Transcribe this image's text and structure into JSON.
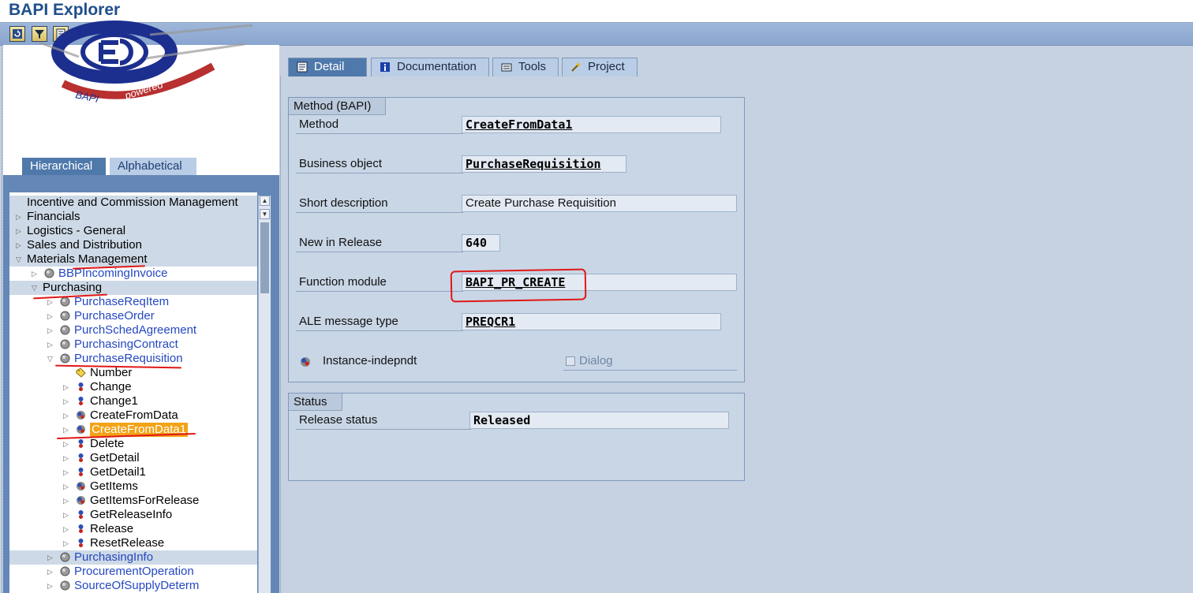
{
  "window": {
    "title": "BAPI Explorer"
  },
  "toolbar": {
    "buttons": [
      {
        "icon": "refresh-icon"
      },
      {
        "icon": "filter-icon"
      },
      {
        "icon": "list-icon"
      }
    ]
  },
  "logo": {
    "text": "BAPIpowered"
  },
  "left_tabs": {
    "hierarchical": "Hierarchical",
    "alphabetical": "Alphabetical"
  },
  "tree": {
    "rows": [
      {
        "label": "Incentive and Commission Management",
        "level": 0,
        "expand": "none",
        "type": "hdr"
      },
      {
        "label": "Financials",
        "level": 0,
        "expand": "closed",
        "type": "hdr"
      },
      {
        "label": "Logistics - General",
        "level": 0,
        "expand": "closed",
        "type": "hdr"
      },
      {
        "label": "Sales and Distribution",
        "level": 0,
        "expand": "closed",
        "type": "hdr"
      },
      {
        "label": "Materials Management",
        "level": 0,
        "expand": "open",
        "type": "hdr"
      },
      {
        "label": "BBPIncomingInvoice",
        "level": 1,
        "expand": "closed",
        "type": "link",
        "icon": "object"
      },
      {
        "label": "Purchasing",
        "level": 1,
        "expand": "open",
        "type": "hdr"
      },
      {
        "label": "PurchaseReqItem",
        "level": 2,
        "expand": "closed",
        "type": "link",
        "icon": "object"
      },
      {
        "label": "PurchaseOrder",
        "level": 2,
        "expand": "closed",
        "type": "link",
        "icon": "object"
      },
      {
        "label": "PurchSchedAgreement",
        "level": 2,
        "expand": "closed",
        "type": "link",
        "icon": "object"
      },
      {
        "label": "PurchasingContract",
        "level": 2,
        "expand": "closed",
        "type": "link",
        "icon": "object"
      },
      {
        "label": "PurchaseRequisition",
        "level": 2,
        "expand": "open",
        "type": "link",
        "icon": "object"
      },
      {
        "label": "Number",
        "level": 3,
        "expand": "none",
        "type": "plain",
        "icon": "key"
      },
      {
        "label": "Change",
        "level": 3,
        "expand": "closed",
        "type": "plain",
        "icon": "method"
      },
      {
        "label": "Change1",
        "level": 3,
        "expand": "closed",
        "type": "plain",
        "icon": "method"
      },
      {
        "label": "CreateFromData",
        "level": 3,
        "expand": "closed",
        "type": "plain",
        "icon": "static"
      },
      {
        "label": "CreateFromData1",
        "level": 3,
        "expand": "closed",
        "type": "sel",
        "icon": "static"
      },
      {
        "label": "Delete",
        "level": 3,
        "expand": "closed",
        "type": "plain",
        "icon": "method"
      },
      {
        "label": "GetDetail",
        "level": 3,
        "expand": "closed",
        "type": "plain",
        "icon": "method"
      },
      {
        "label": "GetDetail1",
        "level": 3,
        "expand": "closed",
        "type": "plain",
        "icon": "method"
      },
      {
        "label": "GetItems",
        "level": 3,
        "expand": "closed",
        "type": "plain",
        "icon": "static"
      },
      {
        "label": "GetItemsForRelease",
        "level": 3,
        "expand": "closed",
        "type": "plain",
        "icon": "static"
      },
      {
        "label": "GetReleaseInfo",
        "level": 3,
        "expand": "closed",
        "type": "plain",
        "icon": "method"
      },
      {
        "label": "Release",
        "level": 3,
        "expand": "closed",
        "type": "plain",
        "icon": "method"
      },
      {
        "label": "ResetRelease",
        "level": 3,
        "expand": "closed",
        "type": "plain",
        "icon": "method"
      },
      {
        "label": "PurchasingInfo",
        "level": 2,
        "expand": "closed",
        "type": "linkhdr",
        "icon": "object"
      },
      {
        "label": "ProcurementOperation",
        "level": 2,
        "expand": "closed",
        "type": "link",
        "icon": "object"
      },
      {
        "label": "SourceOfSupplyDeterm",
        "level": 2,
        "expand": "closed",
        "type": "link",
        "icon": "object"
      }
    ]
  },
  "right_tabs": [
    {
      "label": "Detail",
      "icon": "detail-icon",
      "active": true
    },
    {
      "label": "Documentation",
      "icon": "info-icon",
      "active": false
    },
    {
      "label": "Tools",
      "icon": "tools-icon",
      "active": false
    },
    {
      "label": "Project",
      "icon": "wand-icon",
      "active": false
    }
  ],
  "method_group": {
    "title": "Method (BAPI)",
    "method_label": "Method",
    "method_value": "CreateFromData1",
    "bo_label": "Business object",
    "bo_value": "PurchaseRequisition",
    "short_label": "Short description",
    "short_value": "Create Purchase Requisition",
    "release_label": "New in Release",
    "release_value": "640",
    "fm_label": "Function module",
    "fm_value": "BAPI_PR_CREATE",
    "ale_label": "ALE message type",
    "ale_value": "PREQCR1",
    "instance_label": "Instance-indepndt",
    "dialog_label": "Dialog"
  },
  "status_group": {
    "title": "Status",
    "release_status_label": "Release status",
    "release_status_value": "Released"
  },
  "colors": {
    "accent": "#4f79ab",
    "selection": "#f3a316",
    "annotation": "#e01818",
    "link": "#2447c2"
  }
}
